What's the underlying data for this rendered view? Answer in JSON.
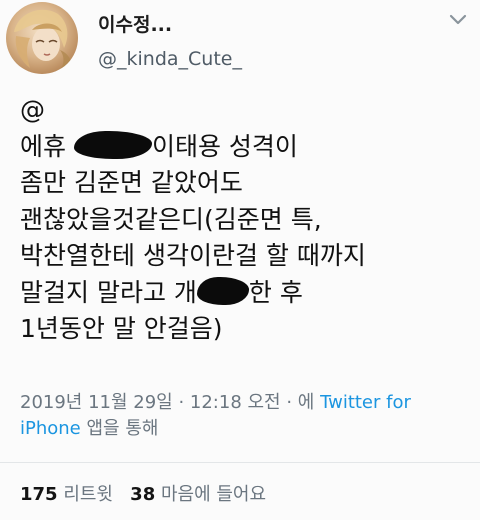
{
  "user": {
    "display_name": "이수정...",
    "handle": "@_kinda_Cute_"
  },
  "tweet": {
    "lines": [
      {
        "before": "@",
        "after": ""
      },
      {
        "before": "에휴 ",
        "after": "이태용 성격이"
      },
      {
        "before": "좀만 김준면 같았어도",
        "after": ""
      },
      {
        "before": "괜찮았을것같은디(김준면 특,",
        "after": ""
      },
      {
        "before": "박찬열한테 생각이란걸 할 때까지",
        "after": ""
      },
      {
        "before": "말걸지 말라고 개",
        "after": "한 후"
      },
      {
        "before": "1년동안 말 안걸음)",
        "after": ""
      }
    ]
  },
  "meta": {
    "timestamp": "2019년 11월 29일 · 12:18 오전 · 에 ",
    "source_line1": "Twitter for",
    "source_line2": "iPhone",
    "source_suffix": " 앱을 통해"
  },
  "stats": {
    "retweets_count": "175",
    "retweets_label": "리트윗",
    "likes_count": "38",
    "likes_label": "마음에 들어요"
  },
  "colors": {
    "link": "#1b95e0",
    "muted": "#6b7680",
    "text": "#141414"
  },
  "icons": {
    "more": "chevron-down-icon"
  }
}
